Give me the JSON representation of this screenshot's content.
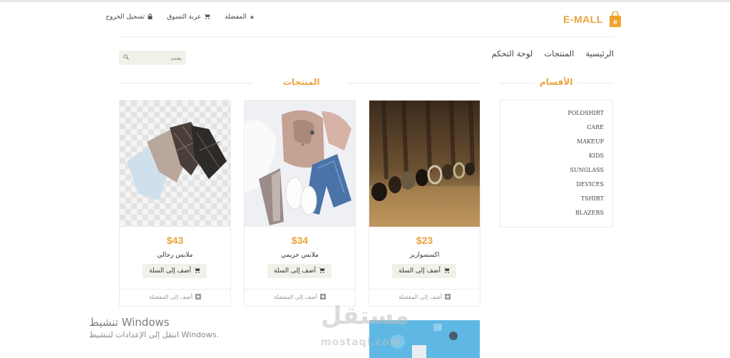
{
  "header": {
    "brand": "E-MALL",
    "top_links": [
      {
        "label": "المفضلة",
        "icon": "star-icon"
      },
      {
        "label": "عربة التسوق",
        "icon": "cart-icon"
      },
      {
        "label": "تسجيل الخروج",
        "icon": "lock-icon"
      }
    ],
    "nav": [
      "الرئيسية",
      "المنتجات",
      "لوحة التحكم"
    ],
    "search_placeholder": "بحث"
  },
  "categories": {
    "title": "الأقسام",
    "items": [
      "POLOSHIRT",
      "CARE",
      "MAKEUP",
      "KIDS",
      "SUNGLASS",
      "DEVICES",
      "TSHIRT",
      "BLAZERS"
    ]
  },
  "products": {
    "title": "المنتجات",
    "add_to_cart": "أضف إلى السلة",
    "add_to_fav": "أضف إلى المفضلة",
    "items": [
      {
        "name": "اكسسواريز",
        "price": "$23"
      },
      {
        "name": "ملابس حريمي",
        "price": "$34"
      },
      {
        "name": "ملابس رجالي",
        "price": "$43"
      }
    ]
  },
  "overlay": {
    "activate_title": "تنشيط Windows",
    "activate_sub": "انتقل إلى الإعدادات لتنشيط Windows.",
    "logo_text": "مستقل",
    "logo_sub": "mostaql.com"
  },
  "colors": {
    "accent": "#e8a33b",
    "button_bg": "#f1f1ea",
    "border": "#ececec"
  }
}
